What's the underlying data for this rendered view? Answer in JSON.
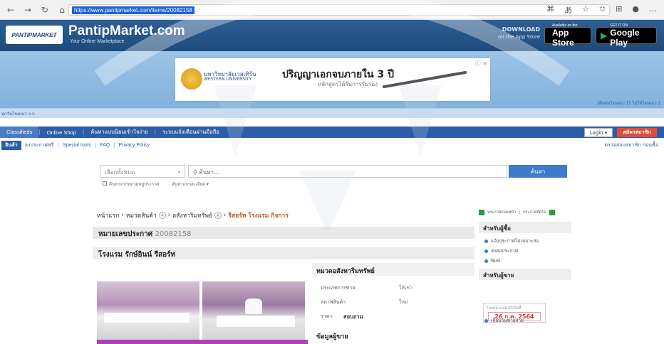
{
  "browser": {
    "url": "https://www.pantipmarket.com/items/20082158"
  },
  "header": {
    "logo_text": "PANTIPMARKET",
    "site_name": "PantipMarket.com",
    "tagline": "Your Online Marketplace",
    "download_line1": "DOWNLOAD",
    "download_line2": "on the App Store",
    "appstore_small": "Available on the",
    "appstore_label": "App Store",
    "googleplay_small": "GET IT ON",
    "googleplay_label": "Google Play"
  },
  "ad": {
    "university": "มหาวิทยาลัยเวสเทิร์น",
    "university_en": "WESTERN UNIVERSITY",
    "headline": "ปริญญาเอกจบภายใน 3 ปี",
    "subline": "หลักสูตรได้รับการรับรอง",
    "close": "ⓘ ✕",
    "side_links": "[ติดต่อโฆษณา ] [ ไม่ให้โฆษณา ]"
  },
  "strip_text": "ทุกวันโฆษณา >>",
  "menu": {
    "items": [
      "Classifieds",
      "Online Shop",
      "ค้นหาแบบนิยมเข้าใจง่าย",
      "ระบบแจ้งเตือนผ่านมือถือ"
    ],
    "login": "Login ▾",
    "signup": "สมัครสมาชิก"
  },
  "subnav": {
    "home": "สินค้า",
    "links": [
      "ลงประกาศฟรี",
      "Special tools",
      "FAQ",
      "Privacy Policy"
    ],
    "right": "ตรวจสอบสมาชิก ก่อนซื้อ"
  },
  "search": {
    "category": "เลือกทั้งหมด",
    "placeholder": "ค้นหา...",
    "button": "ค้นหา",
    "opt1": "ค้นหาจากหมวดหมู่ประกาศ",
    "opt2": "ค้นหาแบบละเอียด ▾"
  },
  "breadcrumb": {
    "items": [
      "หน้าแรก",
      "หมวดสินค้า",
      "อสังหาริมทรัพย์",
      "รีสอร์ท โรงแรม กิจการ"
    ]
  },
  "listing": {
    "announce_label": "หมายเลขประกาศ",
    "announce_number": "20082158",
    "title": "โรงแรม รักษ์อินน์ รีสอร์ท",
    "category_head": "หมวดอสังหาริมทรัพย์",
    "rows": [
      {
        "label": "ประเภทการขาย",
        "value": "ให้เช่า"
      },
      {
        "label": "สภาพสินค้า",
        "value": "ใหม่"
      },
      {
        "label": "ราคา",
        "value": "สอบถาม"
      }
    ],
    "seller_head": "ข้อมูลผู้ขาย"
  },
  "sidebar": {
    "prev": "ประกาศก่อนหน้า",
    "next": "ประกาศถัดไป",
    "buyer_head": "สำหรับผู้ซื้อ",
    "buyer_items": [
      "แจ้งประกาศไม่เหมาะสม",
      "ส่งต่อประกาศ",
      "พิมพ์"
    ],
    "seller_head": "สำหรับผู้ขาย",
    "date_label": "โฆษณาแสดงถึงวันที่",
    "date_value": "26 ก.ค. 2564",
    "seller_items": [
      "เลื่อนวันขายสาย"
    ]
  },
  "colors": {
    "brand_blue": "#2b5ea8",
    "header_blue": "#1e4a7a",
    "signup_red": "#e04b3a",
    "price_orange": "#c05a1b"
  }
}
